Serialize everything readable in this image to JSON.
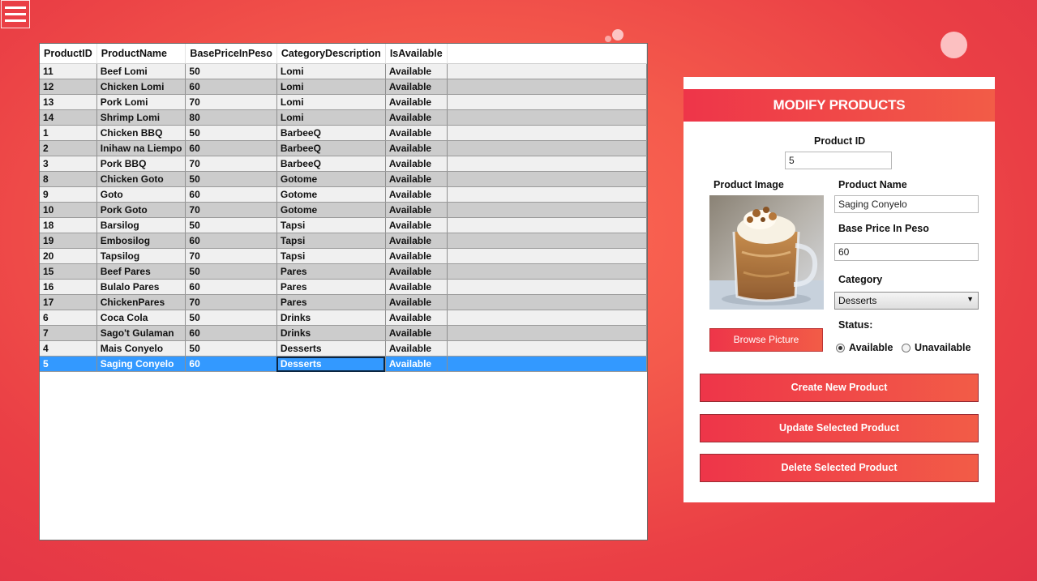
{
  "colors": {
    "accent_start": "#ee3549",
    "accent_end": "#f25c47",
    "selection": "#3399ff"
  },
  "menu": {
    "icon": "hamburger-menu-icon"
  },
  "grid": {
    "columns": [
      "ProductID",
      "ProductName",
      "BasePriceInPeso",
      "CategoryDescription",
      "IsAvailable"
    ],
    "rows": [
      [
        "11",
        "Beef Lomi",
        "50",
        "Lomi",
        "Available"
      ],
      [
        "12",
        "Chicken Lomi",
        "60",
        "Lomi",
        "Available"
      ],
      [
        "13",
        "Pork Lomi",
        "70",
        "Lomi",
        "Available"
      ],
      [
        "14",
        "Shrimp Lomi",
        "80",
        "Lomi",
        "Available"
      ],
      [
        "1",
        "Chicken BBQ",
        "50",
        "BarbeeQ",
        "Available"
      ],
      [
        "2",
        "Inihaw na Liempo",
        "60",
        "BarbeeQ",
        "Available"
      ],
      [
        "3",
        "Pork BBQ",
        "70",
        "BarbeeQ",
        "Available"
      ],
      [
        "8",
        "Chicken Goto",
        "50",
        "Gotome",
        "Available"
      ],
      [
        "9",
        "Goto",
        "60",
        "Gotome",
        "Available"
      ],
      [
        "10",
        "Pork Goto",
        "70",
        "Gotome",
        "Available"
      ],
      [
        "18",
        "Barsilog",
        "50",
        "Tapsi",
        "Available"
      ],
      [
        "19",
        "Embosilog",
        "60",
        "Tapsi",
        "Available"
      ],
      [
        "20",
        "Tapsilog",
        "70",
        "Tapsi",
        "Available"
      ],
      [
        "15",
        "Beef Pares",
        "50",
        "Pares",
        "Available"
      ],
      [
        "16",
        "Bulalo Pares",
        "60",
        "Pares",
        "Available"
      ],
      [
        "17",
        "ChickenPares",
        "70",
        "Pares",
        "Available"
      ],
      [
        "6",
        "Coca Cola",
        "50",
        "Drinks",
        "Available"
      ],
      [
        "7",
        "Sago't Gulaman",
        "60",
        "Drinks",
        "Available"
      ],
      [
        "4",
        "Mais Conyelo",
        "50",
        "Desserts",
        "Available"
      ],
      [
        "5",
        "Saging Conyelo",
        "60",
        "Desserts",
        "Available"
      ]
    ],
    "selected_row": 19
  },
  "panel": {
    "title": "MODIFY PRODUCTS",
    "product_id_label": "Product ID",
    "product_id_value": "5",
    "product_image_label": "Product Image",
    "product_name_label": "Product Name",
    "product_name_value": "Saging Conyelo",
    "base_price_label": "Base Price In Peso",
    "base_price_value": "60",
    "category_label": "Category",
    "category_value": "Desserts",
    "browse_label": "Browse Picture",
    "status_label": "Status:",
    "status_available": "Available",
    "status_unavailable": "Unavailable",
    "status_selected": "Available",
    "create_label": "Create New Product",
    "update_label": "Update Selected Product",
    "delete_label": "Delete Selected Product"
  }
}
